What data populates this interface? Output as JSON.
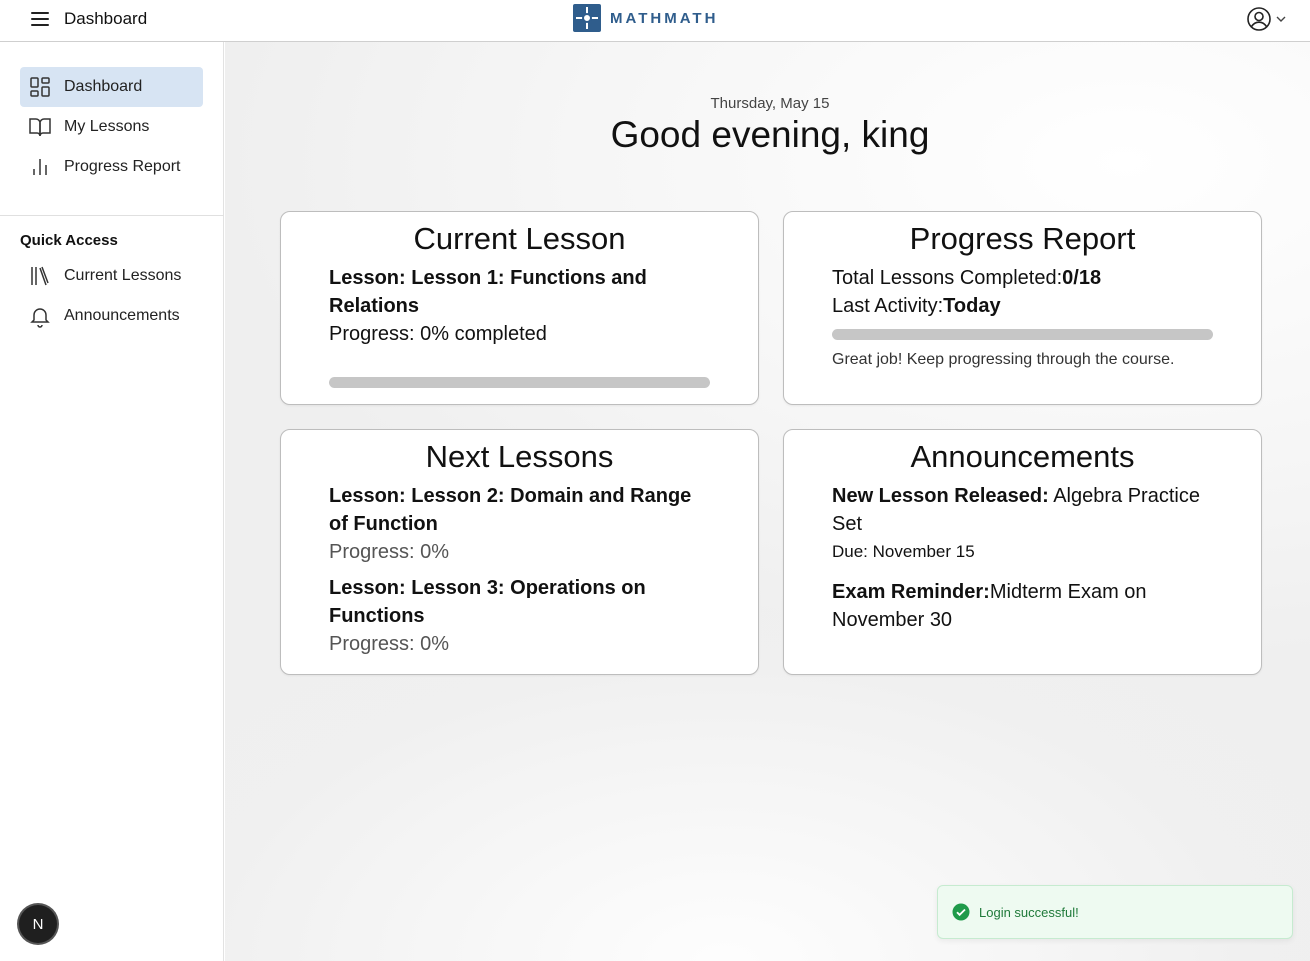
{
  "header": {
    "page_title": "Dashboard",
    "logo_text": "MATHMATH"
  },
  "sidebar": {
    "items": [
      {
        "label": "Dashboard",
        "icon": "dashboard-grid-icon",
        "active": true
      },
      {
        "label": "My Lessons",
        "icon": "book-open-icon"
      },
      {
        "label": "Progress Report",
        "icon": "bar-chart-icon"
      }
    ],
    "quick_access_title": "Quick Access",
    "quick_items": [
      {
        "label": "Current Lessons",
        "icon": "library-icon"
      },
      {
        "label": "Announcements",
        "icon": "bell-icon"
      }
    ],
    "badge": "N"
  },
  "main": {
    "date": "Thursday, May 15",
    "greeting": "Good evening, king"
  },
  "current_lesson": {
    "title": "Current Lesson",
    "lesson": "Lesson: Lesson 1: Functions and Relations",
    "progress_text": "Progress: 0% completed",
    "progress_fraction": 0
  },
  "progress_report": {
    "title": "Progress Report",
    "completed_label": "Total Lessons Completed:",
    "completed_value": "0/18",
    "activity_label": "Last Activity:",
    "activity_value": "Today",
    "progress_fraction": 0,
    "message": "Great job! Keep progressing through the course."
  },
  "next_lessons": {
    "title": "Next Lessons",
    "items": [
      {
        "lesson": "Lesson: Lesson 2: Domain and Range of Function",
        "progress": "Progress: 0%"
      },
      {
        "lesson": "Lesson: Lesson 3: Operations on Functions",
        "progress": "Progress: 0%"
      }
    ]
  },
  "announcements": {
    "title": "Announcements",
    "items": [
      {
        "label": "New Lesson Released:",
        "text": " Algebra Practice Set",
        "due": "Due: November 15"
      },
      {
        "label": "Exam Reminder:",
        "text": "Midterm Exam on November 30"
      }
    ]
  },
  "toast": {
    "message": "Login successful!"
  },
  "colors": {
    "brand": "#2f5d8c",
    "active_nav": "#d7e4f3",
    "success": "#1f9a4a"
  }
}
